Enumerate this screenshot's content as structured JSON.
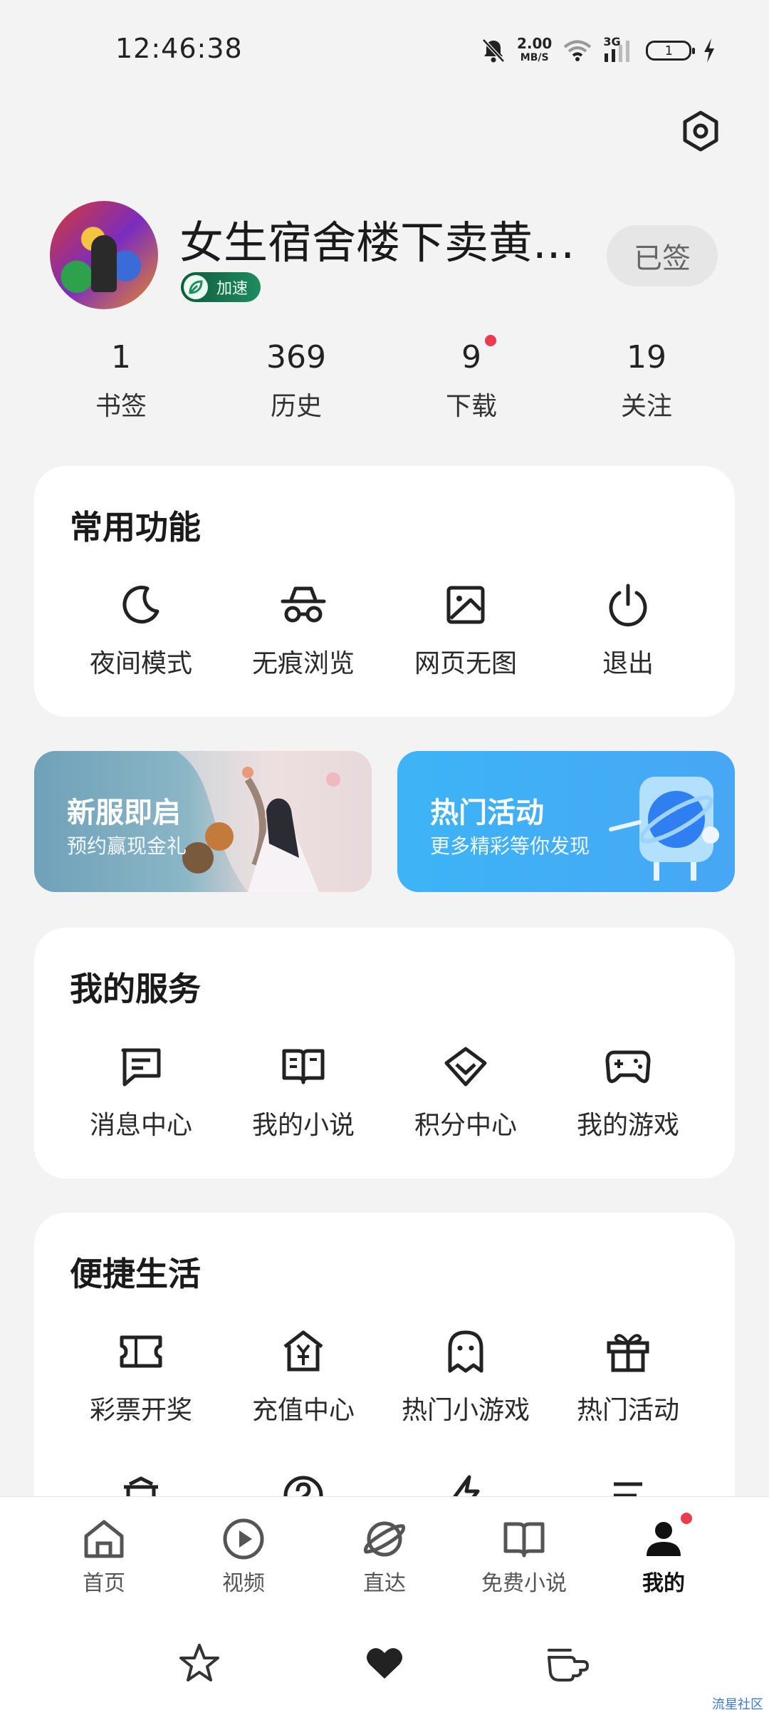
{
  "status_bar": {
    "time": "12:46:38",
    "net_speed_value": "2.00",
    "net_speed_unit": "MB/S",
    "network_type": "3G",
    "battery_level": "1"
  },
  "profile": {
    "username": "女生宿舍楼下卖黄...",
    "speed_badge": "加速",
    "signed_label": "已签"
  },
  "stats": [
    {
      "value": "1",
      "label": "书签"
    },
    {
      "value": "369",
      "label": "历史"
    },
    {
      "value": "9",
      "label": "下载"
    },
    {
      "value": "19",
      "label": "关注"
    }
  ],
  "common_functions": {
    "title": "常用功能",
    "items": [
      {
        "label": "夜间模式",
        "icon": "moon-icon"
      },
      {
        "label": "无痕浏览",
        "icon": "incognito-icon"
      },
      {
        "label": "网页无图",
        "icon": "image-icon"
      },
      {
        "label": "退出",
        "icon": "power-icon"
      }
    ]
  },
  "banners": [
    {
      "title": "新服即启",
      "subtitle": "预约赢现金礼"
    },
    {
      "title": "热门活动",
      "subtitle": "更多精彩等你发现"
    }
  ],
  "my_services": {
    "title": "我的服务",
    "items": [
      {
        "label": "消息中心",
        "icon": "message-icon"
      },
      {
        "label": "我的小说",
        "icon": "book-icon"
      },
      {
        "label": "积分中心",
        "icon": "diamond-icon"
      },
      {
        "label": "我的游戏",
        "icon": "gamepad-icon"
      }
    ]
  },
  "convenient_life": {
    "title": "便捷生活",
    "items": [
      {
        "label": "彩票开奖",
        "icon": "ticket-icon"
      },
      {
        "label": "充值中心",
        "icon": "yen-house-icon"
      },
      {
        "label": "热门小游戏",
        "icon": "ghost-icon"
      },
      {
        "label": "热门活动",
        "icon": "gift-icon"
      }
    ]
  },
  "bottom_nav": [
    {
      "label": "首页",
      "icon": "home-icon"
    },
    {
      "label": "视频",
      "icon": "play-icon"
    },
    {
      "label": "直达",
      "icon": "planet-icon"
    },
    {
      "label": "免费小说",
      "icon": "open-book-icon"
    },
    {
      "label": "我的",
      "icon": "person-icon",
      "active": true
    }
  ],
  "watermark": "流星社区",
  "colors": {
    "background": "#f3f3f3",
    "card": "#ffffff",
    "badge_green": "#1e8c5e",
    "notification_red": "#ec3a4e",
    "banner_blue": "#3db4f6"
  }
}
